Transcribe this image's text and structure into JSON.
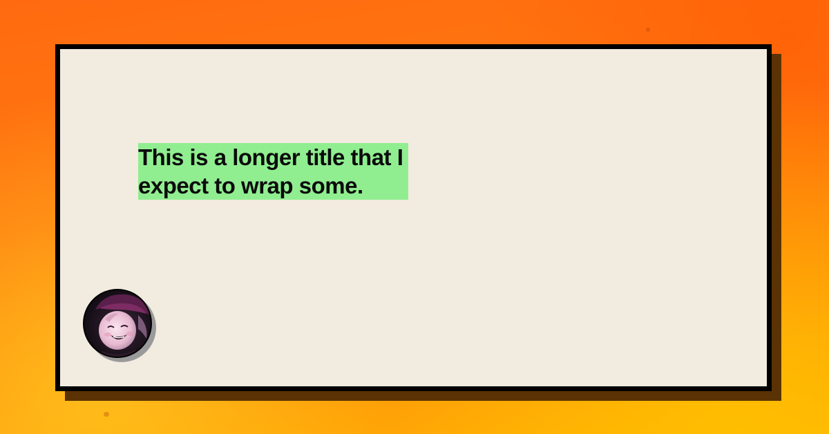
{
  "card": {
    "title": "This is a longer title that I expect to wrap some."
  },
  "avatar": {
    "alt": "profile photo of a smiling child in a purple hat"
  },
  "colors": {
    "background": "#ff7a10",
    "card": "#f2ebe0",
    "card_border": "#000000",
    "card_shadow": "#5a3204",
    "title_highlight": "#90ee90"
  }
}
